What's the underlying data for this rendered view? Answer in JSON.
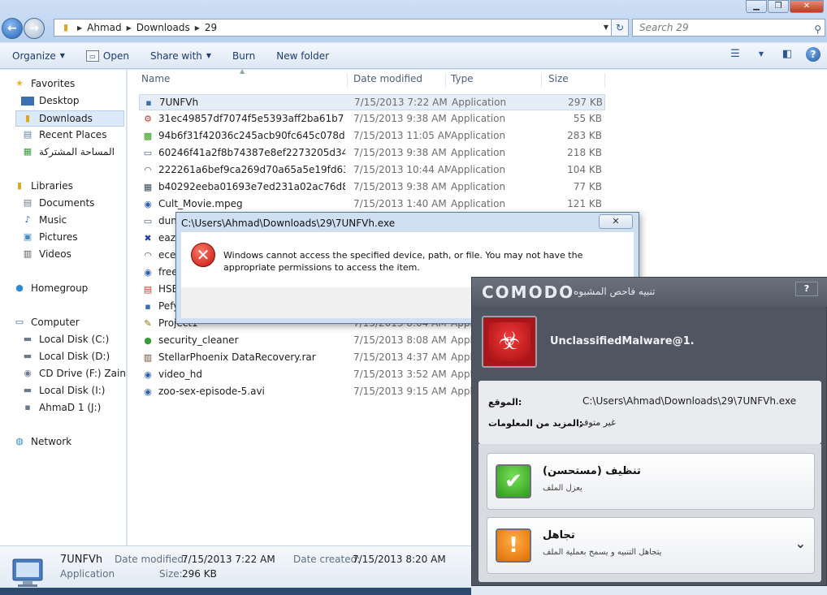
{
  "window": {
    "minimize": "▁",
    "maximize": "❐",
    "close": "✕"
  },
  "nav_buttons": {
    "back": "←",
    "forward": "→"
  },
  "address": {
    "segments": [
      "Ahmad",
      "Downloads",
      "29"
    ],
    "refresh_icon": "↻"
  },
  "search": {
    "placeholder": "Search 29"
  },
  "toolbar": {
    "organize": "Organize",
    "open": "Open",
    "share_with": "Share with",
    "burn": "Burn",
    "new_folder": "New folder"
  },
  "sidebar": {
    "favorites": "Favorites",
    "desktop": "Desktop",
    "downloads": "Downloads",
    "recent_places": "Recent Places",
    "shared": "المساحة المشتركة",
    "libraries": "Libraries",
    "documents": "Documents",
    "music": "Music",
    "pictures": "Pictures",
    "videos": "Videos",
    "homegroup": "Homegroup",
    "computer": "Computer",
    "disk_c": "Local Disk (C:)",
    "disk_d": "Local Disk (D:)",
    "cd_drive": "CD Drive (F:) Zain Br",
    "disk_i": "Local Disk (I:)",
    "ahmad_j": "AhmaD 1 (J:)",
    "network": "Network"
  },
  "columns": {
    "name": "Name",
    "date": "Date modified",
    "type": "Type",
    "size": "Size"
  },
  "files": [
    {
      "name": "7UNFVh",
      "date": "7/15/2013 7:22 AM",
      "type": "Application",
      "size": "297 KB"
    },
    {
      "name": "31ec49857df7074f5e5393aff2ba61b7",
      "date": "7/15/2013 9:38 AM",
      "type": "Application",
      "size": "55 KB"
    },
    {
      "name": "94b6f31f42036c245acb90fc645c078d",
      "date": "7/15/2013 11:05 AM",
      "type": "Application",
      "size": "283 KB"
    },
    {
      "name": "60246f41a2f8b74387e8ef2273205d34",
      "date": "7/15/2013 9:38 AM",
      "type": "Application",
      "size": "218 KB"
    },
    {
      "name": "222261a6bef9ca269d70a65a5e19fd63",
      "date": "7/15/2013 10:44 AM",
      "type": "Application",
      "size": "104 KB"
    },
    {
      "name": "b40292eeba01693e7ed231a02ac76d89",
      "date": "7/15/2013 9:38 AM",
      "type": "Application",
      "size": "77 KB"
    },
    {
      "name": "Cult_Movie.mpeg",
      "date": "7/15/2013 1:40 AM",
      "type": "Application",
      "size": "121 KB"
    },
    {
      "name": "dun",
      "date": "",
      "type": "",
      "size": ""
    },
    {
      "name": "eazf",
      "date": "",
      "type": "",
      "size": ""
    },
    {
      "name": "ecea",
      "date": "",
      "type": "",
      "size": ""
    },
    {
      "name": "free",
      "date": "",
      "type": "",
      "size": ""
    },
    {
      "name": "HSB",
      "date": "",
      "type": "",
      "size": ""
    },
    {
      "name": "Pefy",
      "date": "",
      "type": "",
      "size": ""
    },
    {
      "name": "Project1",
      "date": "7/15/2013 8:04 AM",
      "type": "Appli",
      "size": ""
    },
    {
      "name": "security_cleaner",
      "date": "7/15/2013 8:08 AM",
      "type": "Appli",
      "size": ""
    },
    {
      "name": "StellarPhoenix DataRecovery.rar",
      "date": "7/15/2013 4:37 AM",
      "type": "Appli",
      "size": ""
    },
    {
      "name": "video_hd",
      "date": "7/15/2013 3:52 AM",
      "type": "Appli",
      "size": ""
    },
    {
      "name": "zoo-sex-episode-5.avi",
      "date": "7/15/2013 9:15 AM",
      "type": "Appli",
      "size": ""
    }
  ],
  "details": {
    "name": "7UNFVh",
    "type": "Application",
    "date_modified_label": "Date modified:",
    "date_modified": "7/15/2013 7:22 AM",
    "date_created_label": "Date created:",
    "date_created": "7/15/2013 8:20 AM",
    "size_label": "Size:",
    "size": "296 KB"
  },
  "error_dialog": {
    "title": "C:\\Users\\Ahmad\\Downloads\\29\\7UNFVh.exe",
    "message": "Windows cannot access the specified device, path, or file.  You may not have the appropriate permissions to access the item.",
    "close": "✕"
  },
  "comodo": {
    "logo": "COMODO",
    "subtitle": "تنبيه فاحص المشبوه",
    "help": "?",
    "threat_name": "UnclassifiedMalware@1.",
    "location_label": "الموقع:",
    "location_value": "C:\\Users\\Ahmad\\Downloads\\29\\7UNFVh.exe",
    "more_label": "المزيد من المعلومات:",
    "more_value": "غير متوفر",
    "clean_title": "تنظيف (مستحسن)",
    "clean_desc": "يعزل الملف",
    "ignore_title": "تجاهل",
    "ignore_desc": "يتجاهل التنبيه و يسمح بعملية الملف",
    "colors": {
      "threat_red": "#c1151a",
      "clean_green": "#3bb01f",
      "ignore_orange": "#f28a0a"
    }
  }
}
